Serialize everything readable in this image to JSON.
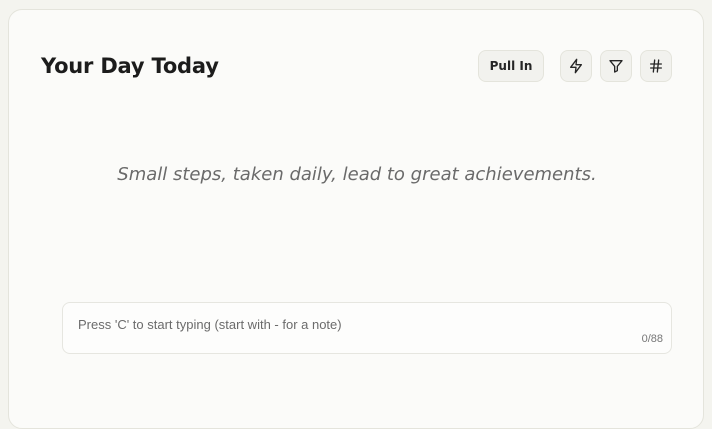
{
  "header": {
    "title": "Your Day Today",
    "pull_in_label": "Pull In",
    "icons": [
      "lightning-icon",
      "filter-icon",
      "hashtag-icon"
    ]
  },
  "motivation": {
    "quote": "Small steps, taken daily, lead to great achievements."
  },
  "composer": {
    "placeholder": "Press 'C' to start typing (start with - for a note)",
    "value": "",
    "counter": "0/88"
  },
  "colors": {
    "background": "#f4f4ef",
    "card": "#fbfbf9",
    "button": "#f2f2ee",
    "text": "#1c1c1c"
  }
}
